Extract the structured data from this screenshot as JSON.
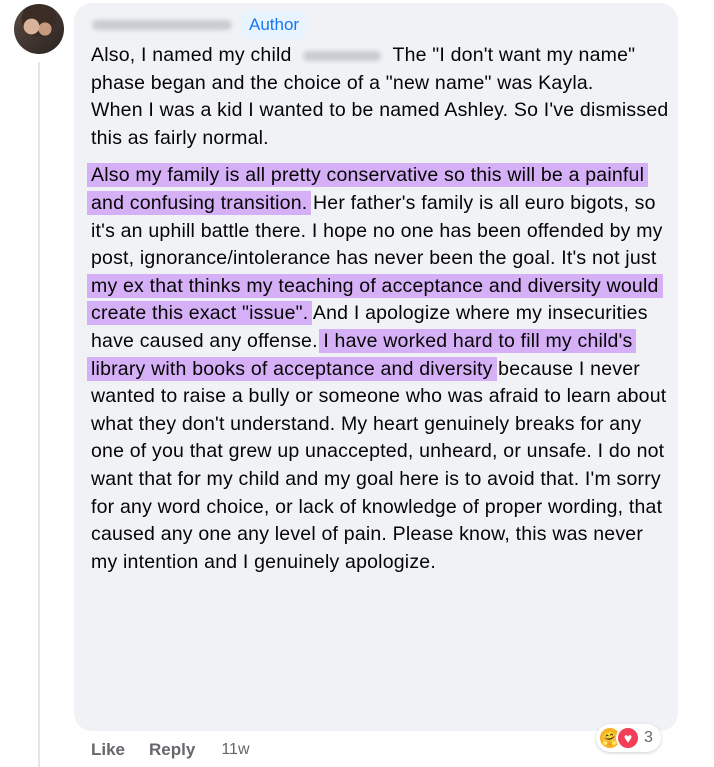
{
  "comment": {
    "author_badge": "Author",
    "paragraphs": [
      {
        "segments": [
          {
            "text": "Also, I named my child "
          },
          {
            "redacted": true
          },
          {
            "text": " The \"I don't want my name\" phase began and the choice of a \"new name\" was Kayla."
          }
        ]
      },
      {
        "segments": [
          {
            "text": "When I was a kid I wanted to be named Ashley. So I've dismissed this as fairly normal."
          }
        ]
      },
      {
        "gap": true
      },
      {
        "segments": [
          {
            "text": "Also my family is all pretty conservative so this will be a painful and confusing transition.",
            "highlight": true
          },
          {
            "text": " Her father's family is all euro bigots, so it's an uphill battle there. I hope no one has been offended by my post, ignorance/intolerance has never been the goal. It's not just "
          },
          {
            "text": "my ex that thinks my teaching of acceptance and diversity would create this exact \"issue\".",
            "highlight": true
          },
          {
            "text": " And I apologize where my insecurities have caused any offense. "
          },
          {
            "text": "I have worked hard to fill my child's library with books of acceptance and diversity",
            "highlight": true
          },
          {
            "text": " because I never wanted to raise a bully or someone who was afraid to learn about what they don't understand. My heart genuinely breaks for any one of you that grew up unaccepted, unheard, or unsafe. I do not want that for my child and my goal here is to avoid that. I'm sorry for any word choice, or lack of knowledge of proper wording, that caused any one any level of pain. Please know, this was never my intention and I genuinely apologize."
          }
        ]
      }
    ],
    "reactions": {
      "icons": [
        "care-icon",
        "love-icon"
      ],
      "count": "3"
    },
    "actions": {
      "like": "Like",
      "reply": "Reply"
    },
    "timestamp": "11w"
  },
  "colors": {
    "highlight": "#d6b0f7",
    "bubble": "#f0f2f5",
    "badge_text": "#1877f2",
    "badge_bg": "#e7f3ff"
  }
}
